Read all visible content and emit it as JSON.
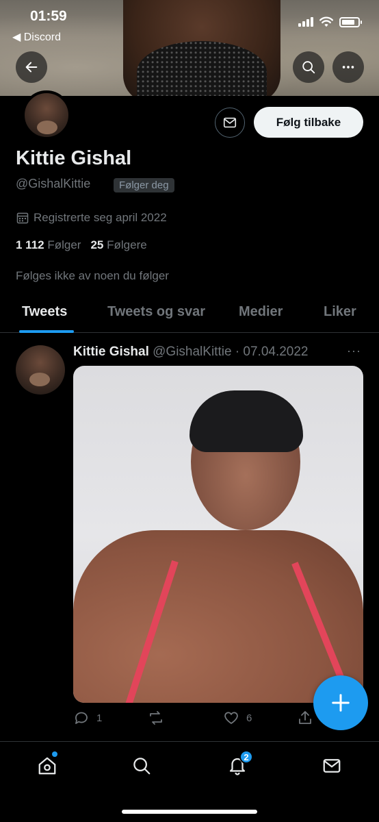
{
  "status_bar": {
    "time": "01:59",
    "back_app": "◀ Discord"
  },
  "profile": {
    "name": "Kittie Gishal",
    "handle": "@GishalKittie",
    "follows_you": "Følger deg",
    "joined": "Registrerte seg april 2022",
    "following_count": "1 112",
    "following_label": "Følger",
    "followers_count": "25",
    "followers_label": "Følgere",
    "not_followed_note": "Følges ikke av noen du følger",
    "follow_back_label": "Følg tilbake"
  },
  "tabs": [
    {
      "label": "Tweets",
      "active": true
    },
    {
      "label": "Tweets og svar",
      "active": false
    },
    {
      "label": "Medier",
      "active": false
    },
    {
      "label": "Liker",
      "active": false
    }
  ],
  "tweet": {
    "author_name": "Kittie Gishal",
    "author_meta": "@GishalKittie · 07.04.2022",
    "more": "···",
    "reply_count": "1",
    "retweet_count": "",
    "like_count": "6"
  },
  "bottom_nav": {
    "notifications_badge": "2"
  },
  "colors": {
    "accent": "#1d9bf0",
    "background": "#000000",
    "muted": "#71767b"
  }
}
